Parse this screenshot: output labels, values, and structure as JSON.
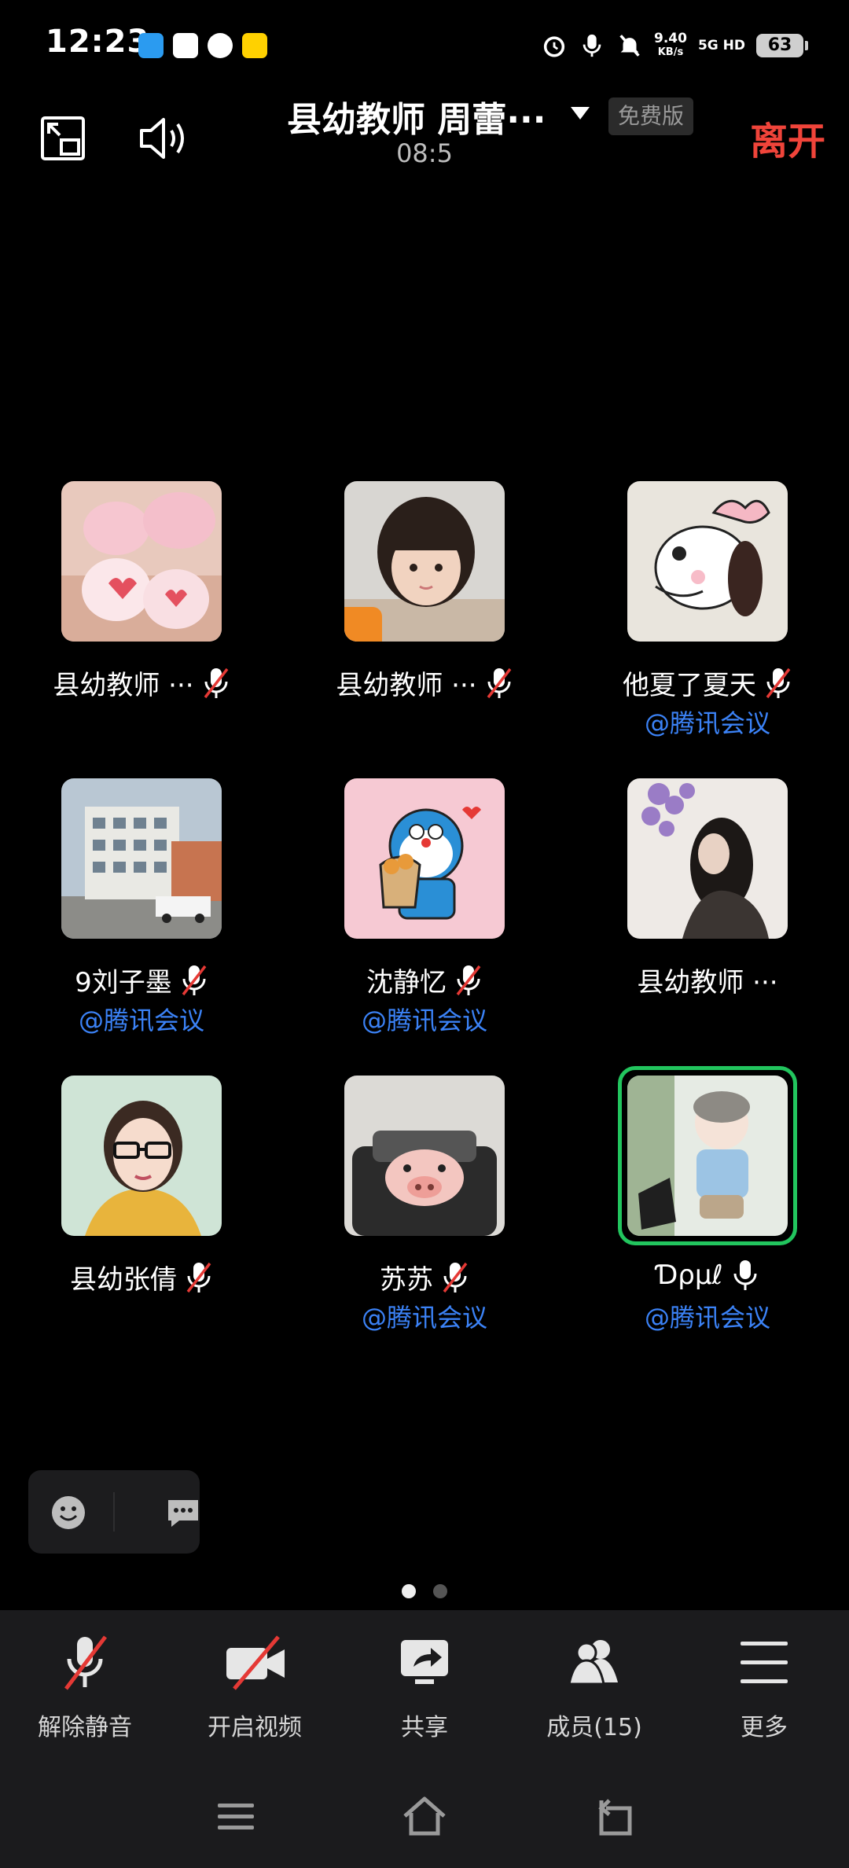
{
  "status_bar": {
    "time": "12:23",
    "net_speed_value": "9.40",
    "net_speed_unit": "KB/s",
    "network": "5G HD",
    "battery": "63",
    "icons": [
      "qq-icon",
      "white-square-app-icon",
      "browser-icon",
      "meituan-icon",
      "alarm-icon",
      "mic-status-icon",
      "mute-notifications-icon",
      "signal-icon",
      "battery-icon"
    ]
  },
  "header": {
    "title": "县幼教师  周蕾···",
    "plan_badge": "免费版",
    "timer": "08:5",
    "leave": "离开"
  },
  "participants": [
    {
      "name": "县幼教师 ···",
      "sub": "",
      "mic": "muted",
      "avatar": "marshmallow-hearts"
    },
    {
      "name": "县幼教师 ···",
      "sub": "",
      "mic": "muted",
      "avatar": "girl-photo",
      "host": true
    },
    {
      "name": "他夏了夏天",
      "sub": "@腾讯会议",
      "mic": "muted",
      "avatar": "snoopy-bow"
    },
    {
      "name": "9刘子墨",
      "sub": "@腾讯会议",
      "mic": "muted",
      "avatar": "school-building"
    },
    {
      "name": "沈静忆",
      "sub": "@腾讯会议",
      "mic": "muted",
      "avatar": "doraemon"
    },
    {
      "name": "县幼教师 ···",
      "sub": "",
      "mic": "none",
      "avatar": "girl-wisteria"
    },
    {
      "name": "县幼张倩",
      "sub": "",
      "mic": "muted",
      "avatar": "woman-glasses"
    },
    {
      "name": "苏苏",
      "sub": "@腾讯会议",
      "mic": "muted",
      "avatar": "pig-in-car"
    },
    {
      "name": "Ɗρµℓ",
      "sub": "@腾讯会议",
      "mic": "on",
      "avatar": "baby-photo",
      "speaking": true
    }
  ],
  "pager": {
    "pages": 2,
    "current": 1
  },
  "toolbar": {
    "unmute": "解除静音",
    "video": "开启视频",
    "share": "共享",
    "members": "成员(15)",
    "more": "更多"
  },
  "colors": {
    "leave": "#f0443a",
    "accent_link": "#3b82f6",
    "speaking_ring": "#22c55e",
    "muted_slash": "#e53935"
  }
}
